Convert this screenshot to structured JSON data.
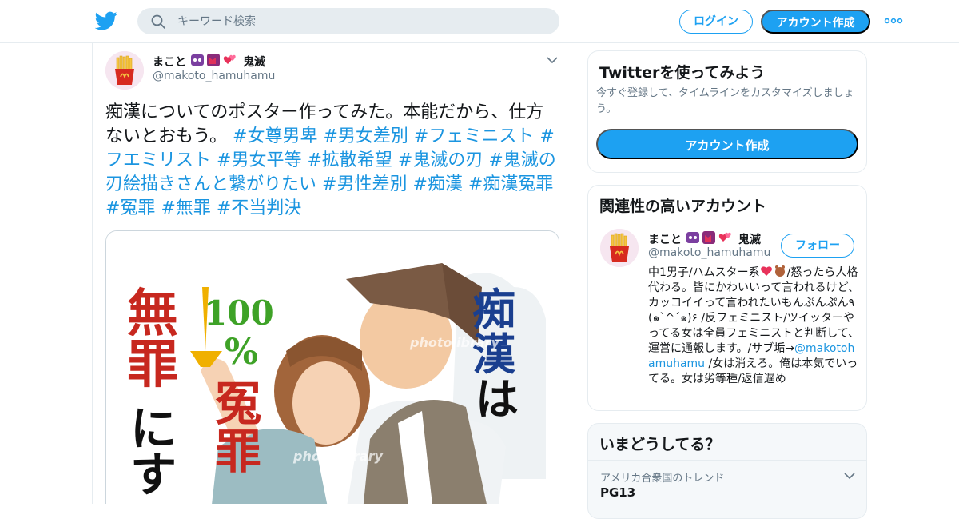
{
  "header": {
    "search_placeholder": "キーワード検索",
    "login_label": "ログイン",
    "signup_label": "アカウント作成",
    "brand_color": "#1da1f2"
  },
  "tweet": {
    "author_name": "まこと",
    "author_name_suffix": "鬼滅",
    "author_handle": "@makoto_hamuhamu",
    "text_parts": [
      {
        "t": "痴漢についてのポスター作ってみた。本能だから、仕方ないとおもう。 ",
        "tag": false
      },
      {
        "t": "#女尊男卑",
        "tag": true
      },
      {
        "t": " ",
        "tag": false
      },
      {
        "t": "#男女差別",
        "tag": true
      },
      {
        "t": " ",
        "tag": false
      },
      {
        "t": "#フェミニスト",
        "tag": true
      },
      {
        "t": " ",
        "tag": false
      },
      {
        "t": "#フエミリスト",
        "tag": true
      },
      {
        "t": " ",
        "tag": false
      },
      {
        "t": "#男女平等",
        "tag": true
      },
      {
        "t": " ",
        "tag": false
      },
      {
        "t": "#拡散希望",
        "tag": true
      },
      {
        "t": " ",
        "tag": false
      },
      {
        "t": "#鬼滅の刃",
        "tag": true
      },
      {
        "t": "  ",
        "tag": false
      },
      {
        "t": "#鬼滅の刃絵描きさんと繋がりたい",
        "tag": true
      },
      {
        "t": " ",
        "tag": false
      },
      {
        "t": "#男性差別",
        "tag": true
      },
      {
        "t": " ",
        "tag": false
      },
      {
        "t": "#痴漢",
        "tag": true
      },
      {
        "t": " ",
        "tag": false
      },
      {
        "t": "#痴漢冤罪",
        "tag": true
      },
      {
        "t": " ",
        "tag": false
      },
      {
        "t": "#冤罪",
        "tag": true
      },
      {
        "t": " ",
        "tag": false
      },
      {
        "t": "#無罪",
        "tag": true
      },
      {
        "t": "  ",
        "tag": false
      },
      {
        "t": "#不当判決",
        "tag": true
      }
    ],
    "media": {
      "left_text_1": "無罪",
      "left_text_2": "にす",
      "percent_num": "100",
      "percent_sign": "%",
      "center_text": "冤罪",
      "right_text_1": "痴漢",
      "right_text_2": "は",
      "watermark": "photolibrary"
    }
  },
  "sidebar": {
    "signup_card": {
      "title": "Twitterを使ってみよう",
      "description": "今すぐ登録して、タイムラインをカスタマイズしましょう。",
      "button_label": "アカウント作成"
    },
    "related": {
      "title": "関連性の高いアカウント",
      "name": "まこと",
      "name_suffix": "鬼滅",
      "handle": "@makoto_hamuhamu",
      "follow_label": "フォロー",
      "bio_before": "中1男子/ハムスター系",
      "bio_mid": "/怒ったら人格代わる。皆にかわいいって言われるけど、カッコイイって言われたいもんぷんぷん٩(๑`^´๑)۶ /反フェミニスト/ツイッターやってる女は全員フェミニストと判断して、運営に通報します。/サブ垢→",
      "bio_mention": "@makotohamuhamu",
      "bio_after": " /女は消えろ。俺は本気でいってる。女は劣等種/返信遅め"
    },
    "trends": {
      "title": "いまどうしてる？",
      "location": "アメリカ合衆国のトレンド",
      "trend_name": "PG13"
    }
  }
}
